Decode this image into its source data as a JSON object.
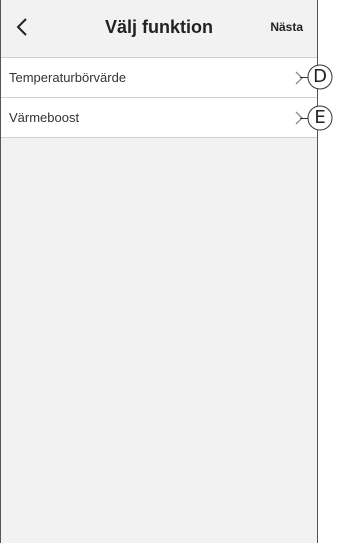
{
  "header": {
    "title": "Välj funktion",
    "next_label": "Nästa",
    "back_icon": "chevron-left-icon"
  },
  "functions": [
    {
      "label": "Temperaturbörvärde",
      "callout": "D"
    },
    {
      "label": "Värmeboost",
      "callout": "E"
    }
  ],
  "colors": {
    "background": "#f2f2f2",
    "list_background": "#ffffff",
    "divider": "#cfcfcf",
    "text": "#333333"
  }
}
